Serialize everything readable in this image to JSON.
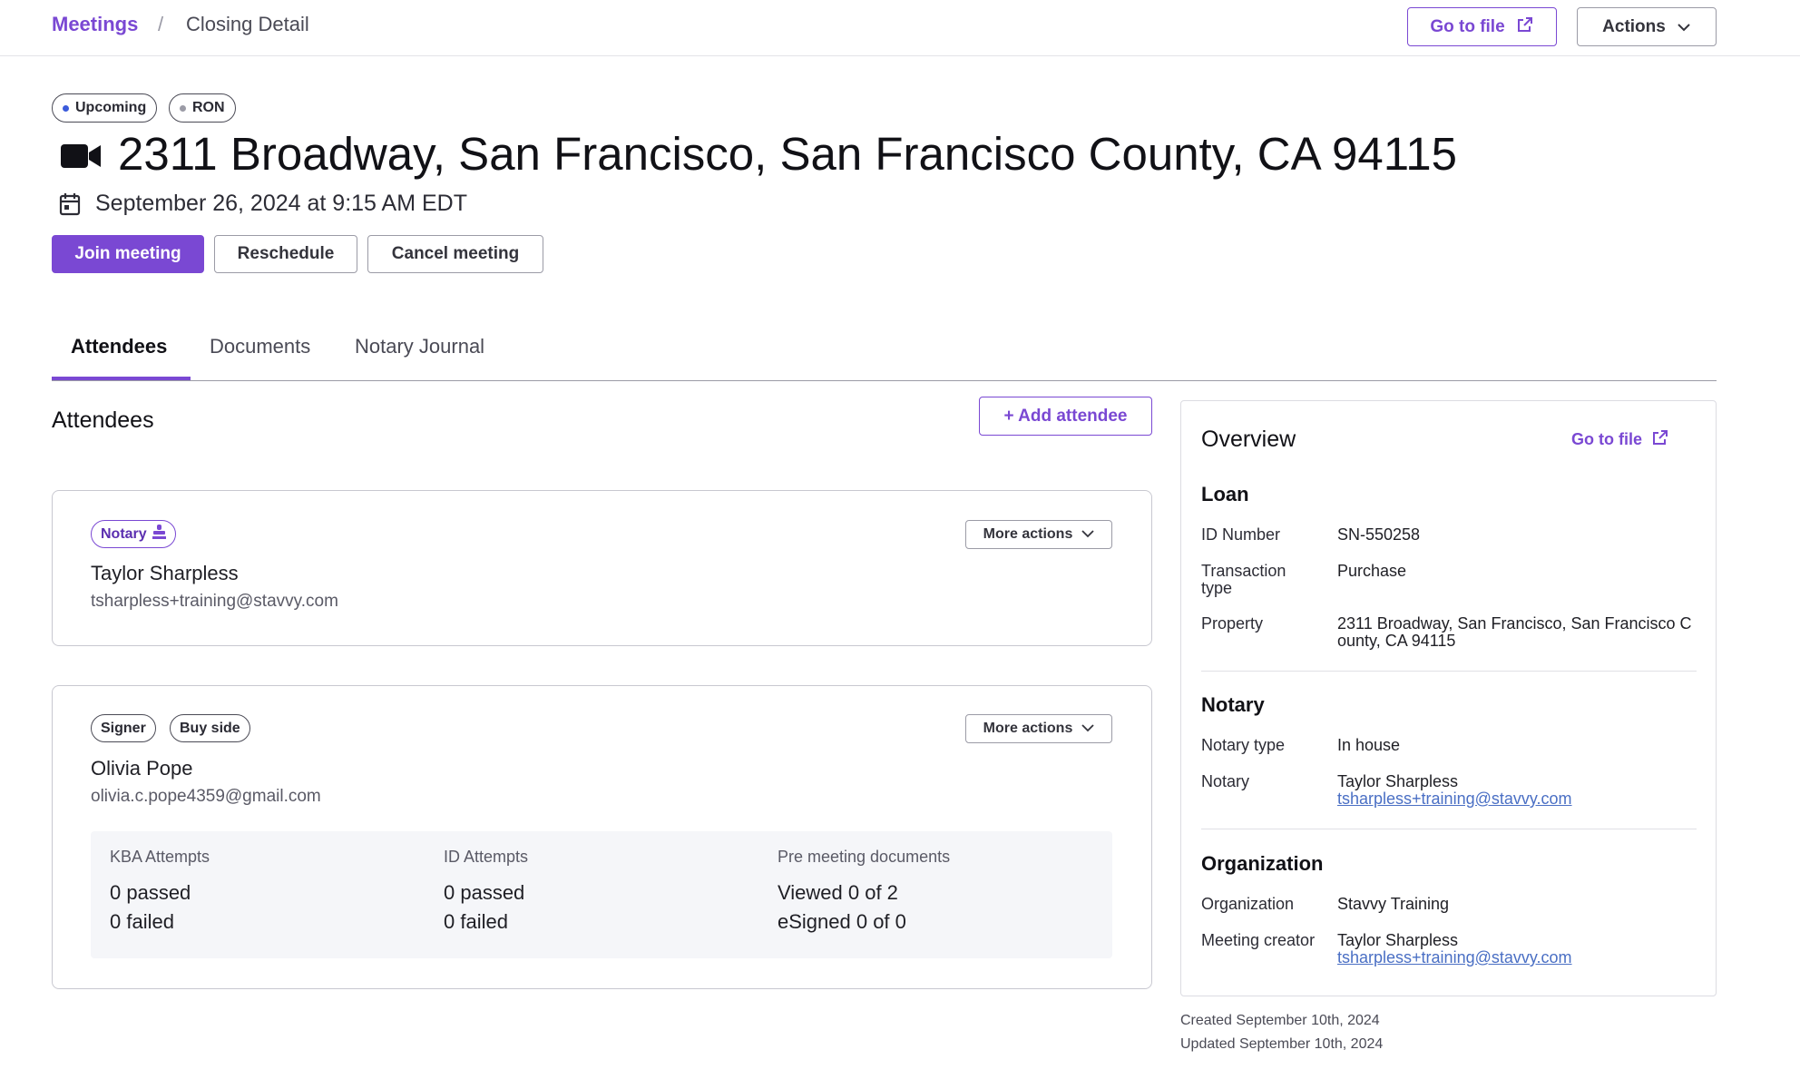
{
  "breadcrumb": {
    "parent": "Meetings",
    "separator": "/",
    "current": "Closing Detail"
  },
  "header_actions": {
    "go_to_file": "Go to file",
    "actions": "Actions"
  },
  "status_badges": [
    {
      "label": "Upcoming",
      "dot_color": "#3b5bdb"
    },
    {
      "label": "RON",
      "dot_color": "#9b9ba6"
    }
  ],
  "meeting": {
    "title": "2311 Broadway, San Francisco, San Francisco County, CA 94115",
    "datetime": "September 26, 2024 at 9:15 AM EDT"
  },
  "meeting_actions": {
    "join": "Join meeting",
    "reschedule": "Reschedule",
    "cancel": "Cancel meeting"
  },
  "tabs": [
    {
      "label": "Attendees",
      "active": true
    },
    {
      "label": "Documents",
      "active": false
    },
    {
      "label": "Notary Journal",
      "active": false
    }
  ],
  "attendees_section": {
    "title": "Attendees",
    "add_button": "+ Add attendee",
    "more_actions": "More actions",
    "items": [
      {
        "roles": [
          "Notary"
        ],
        "name": "Taylor Sharpless",
        "email": "tsharpless+training@stavvy.com"
      },
      {
        "roles": [
          "Signer",
          "Buy side"
        ],
        "name": "Olivia Pope",
        "email": "olivia.c.pope4359@gmail.com",
        "stats": [
          {
            "label": "KBA Attempts",
            "line1": "0 passed",
            "line2": "0 failed"
          },
          {
            "label": "ID Attempts",
            "line1": "0 passed",
            "line2": "0 failed"
          },
          {
            "label": "Pre meeting documents",
            "line1": "Viewed 0 of 2",
            "line2": "eSigned 0 of 0"
          }
        ]
      }
    ]
  },
  "overview": {
    "title": "Overview",
    "go_to_file": "Go to file",
    "loan": {
      "heading": "Loan",
      "id_label": "ID Number",
      "id_value": "SN-550258",
      "type_label": "Transaction type",
      "type_value": "Purchase",
      "property_label": "Property",
      "property_value": "2311 Broadway, San Francisco, San Francisco County, CA 94115"
    },
    "notary": {
      "heading": "Notary",
      "type_label": "Notary type",
      "type_value": "In house",
      "notary_label": "Notary",
      "notary_name": "Taylor Sharpless",
      "notary_email": "tsharpless+training@stavvy.com"
    },
    "organization": {
      "heading": "Organization",
      "org_label": "Organization",
      "org_value": "Stavvy Training",
      "creator_label": "Meeting creator",
      "creator_name": "Taylor Sharpless",
      "creator_email": "tsharpless+training@stavvy.com"
    }
  },
  "meta": {
    "created": "Created September 10th, 2024",
    "updated": "Updated September 10th, 2024"
  },
  "colors": {
    "accent": "#7a48d3",
    "link": "#4a6fc4"
  }
}
